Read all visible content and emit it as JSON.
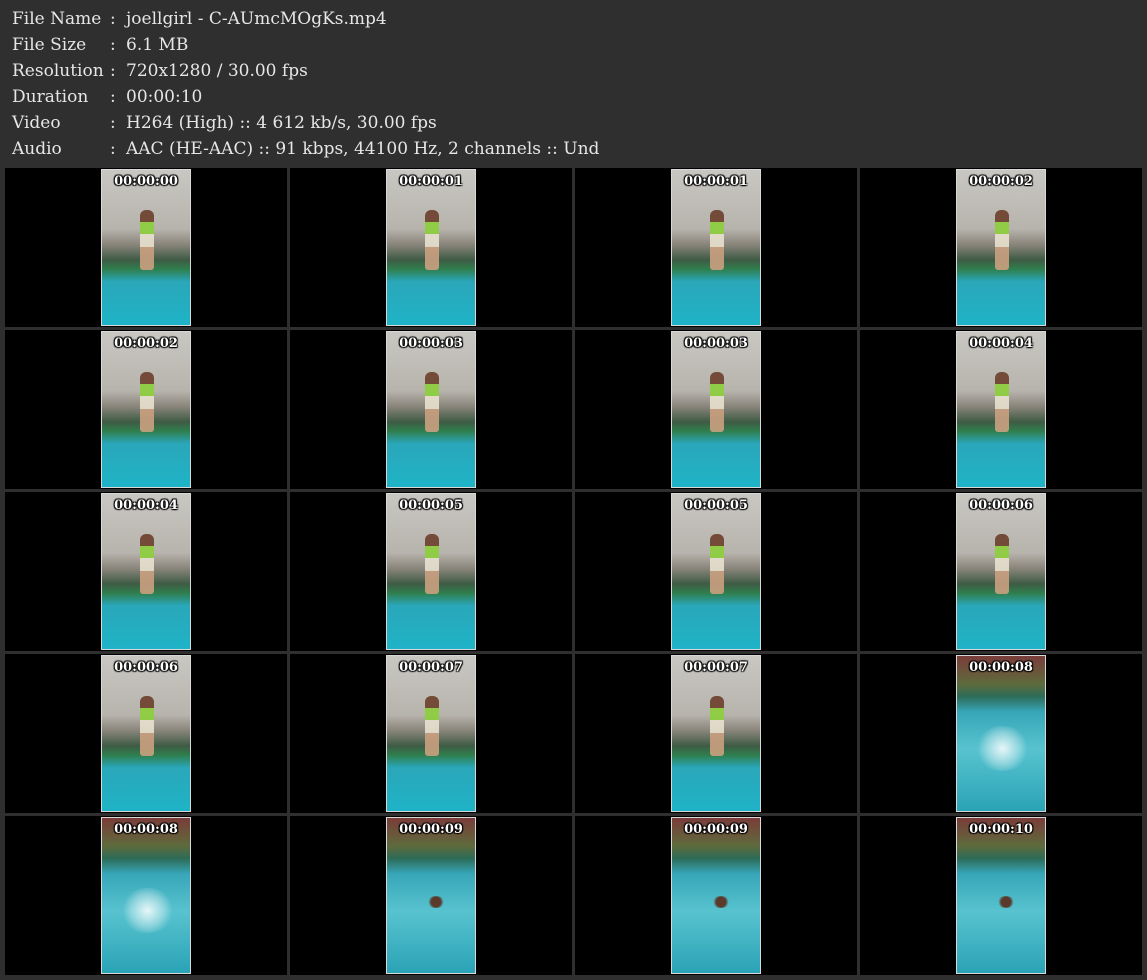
{
  "info": [
    {
      "key": "File Name",
      "sep": ":",
      "value": "joellgirl - C-AUmcMOgKs.mp4"
    },
    {
      "key": "File Size",
      "sep": ":",
      "value": "6.1 MB"
    },
    {
      "key": "Resolution",
      "sep": ":",
      "value": "720x1280 / 30.00 fps"
    },
    {
      "key": "Duration",
      "sep": ":",
      "value": "00:00:10"
    },
    {
      "key": "Video",
      "sep": ":",
      "value": "H264 (High) :: 4 612 kb/s, 30.00 fps"
    },
    {
      "key": "Audio",
      "sep": ":",
      "value": "AAC (HE-AAC) :: 91 kbps, 44100 Hz, 2 channels :: Und"
    }
  ],
  "thumbnails": [
    {
      "time": "00:00:00",
      "scene": "pool-top"
    },
    {
      "time": "00:00:01",
      "scene": "pool-top"
    },
    {
      "time": "00:00:01",
      "scene": "pool-top"
    },
    {
      "time": "00:00:02",
      "scene": "pool-top"
    },
    {
      "time": "00:00:02",
      "scene": "pool-top"
    },
    {
      "time": "00:00:03",
      "scene": "pool-top"
    },
    {
      "time": "00:00:03",
      "scene": "pool-top"
    },
    {
      "time": "00:00:04",
      "scene": "pool-top"
    },
    {
      "time": "00:00:04",
      "scene": "pool-top"
    },
    {
      "time": "00:00:05",
      "scene": "pool-top"
    },
    {
      "time": "00:00:05",
      "scene": "pool-top"
    },
    {
      "time": "00:00:06",
      "scene": "pool-top"
    },
    {
      "time": "00:00:06",
      "scene": "pool-top"
    },
    {
      "time": "00:00:07",
      "scene": "pool-top"
    },
    {
      "time": "00:00:07",
      "scene": "pool-top"
    },
    {
      "time": "00:00:08",
      "scene": "splash"
    },
    {
      "time": "00:00:08",
      "scene": "splash"
    },
    {
      "time": "00:00:09",
      "scene": "swim"
    },
    {
      "time": "00:00:09",
      "scene": "swim"
    },
    {
      "time": "00:00:10",
      "scene": "swim"
    }
  ],
  "colors": {
    "background": "#2f2f2f",
    "cell": "#000000",
    "text": "#e6e6e6",
    "timestamp": "#ffffff"
  }
}
